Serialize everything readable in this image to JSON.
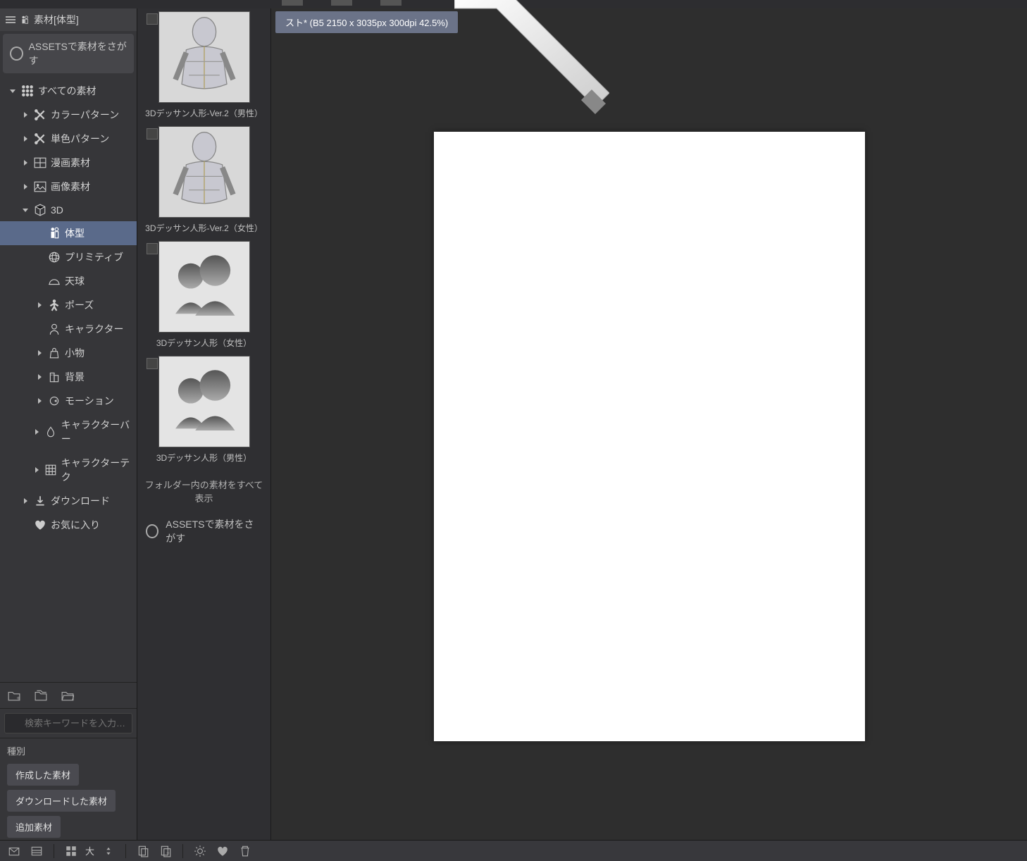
{
  "panel": {
    "title": "素材[体型]",
    "assets_search": "ASSETSで素材をさがす"
  },
  "tree": {
    "all_materials": "すべての素材",
    "color_pattern": "カラーパターン",
    "mono_pattern": "単色パターン",
    "manga": "漫画素材",
    "image": "画像素材",
    "three_d": "3D",
    "body_type": "体型",
    "primitive": "プリミティブ",
    "sky": "天球",
    "pose": "ポーズ",
    "character": "キャラクター",
    "props": "小物",
    "background": "背景",
    "motion": "モーション",
    "char_bar": "キャラクターバー",
    "char_tech": "キャラクターテク",
    "download": "ダウンロード",
    "favorite": "お気に入り"
  },
  "search": {
    "placeholder": "検索キーワードを入力…"
  },
  "filter": {
    "label": "種別",
    "created": "作成した素材",
    "downloaded": "ダウンロードした素材",
    "additional": "追加素材"
  },
  "thumbs": {
    "items": [
      {
        "label": "3Dデッサン人形-Ver.2（男性）",
        "kind": "mannequin-male"
      },
      {
        "label": "3Dデッサン人形-Ver.2（女性）",
        "kind": "mannequin-female"
      },
      {
        "label": "3Dデッサン人形（女性）",
        "kind": "silhouette"
      },
      {
        "label": "3Dデッサン人形（男性）",
        "kind": "silhouette"
      }
    ],
    "show_all": "フォルダー内の素材をすべて表示",
    "assets_footer": "ASSETSで素材をさがす"
  },
  "document": {
    "tab_label": "スト* (B5 2150 x 3035px 300dpi 42.5%)"
  },
  "bottombar": {
    "view_label": "大"
  }
}
